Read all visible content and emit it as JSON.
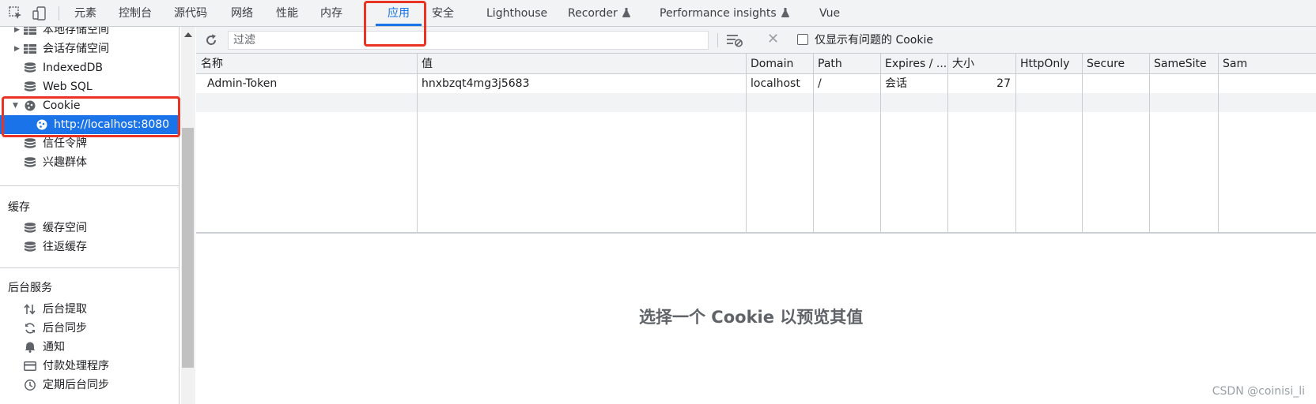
{
  "toolbar": {
    "tabs": [
      {
        "label": "元素"
      },
      {
        "label": "控制台"
      },
      {
        "label": "源代码"
      },
      {
        "label": "网络"
      },
      {
        "label": "性能"
      },
      {
        "label": "内存"
      },
      {
        "label": "应用",
        "active": true
      },
      {
        "label": "安全"
      },
      {
        "label": "Lighthouse"
      },
      {
        "label": "Recorder",
        "icon": "flask-icon"
      },
      {
        "label": "Performance insights",
        "icon": "flask-icon"
      },
      {
        "label": "Vue"
      }
    ]
  },
  "sidebar": {
    "storage_items": [
      {
        "label": "本地存储空间",
        "icon": "grid-icon"
      },
      {
        "label": "会话存储空间",
        "icon": "grid-icon"
      },
      {
        "label": "IndexedDB",
        "icon": "database-icon"
      },
      {
        "label": "Web SQL",
        "icon": "database-icon"
      },
      {
        "label": "Cookie",
        "icon": "cookie-icon"
      },
      {
        "label": "http://localhost:8080",
        "icon": "cookie-icon",
        "selected": true
      },
      {
        "label": "信任令牌",
        "icon": "database-icon"
      },
      {
        "label": "兴趣群体",
        "icon": "database-icon"
      }
    ],
    "cache": {
      "title": "缓存",
      "items": [
        {
          "label": "缓存空间",
          "icon": "database-icon"
        },
        {
          "label": "往返缓存",
          "icon": "database-icon"
        }
      ]
    },
    "background": {
      "title": "后台服务",
      "items": [
        {
          "label": "后台提取",
          "icon": "arrows-updown-icon"
        },
        {
          "label": "后台同步",
          "icon": "sync-icon"
        },
        {
          "label": "通知",
          "icon": "bell-icon"
        },
        {
          "label": "付款处理程序",
          "icon": "card-icon"
        },
        {
          "label": "定期后台同步",
          "icon": "clock-icon"
        }
      ]
    }
  },
  "filter": {
    "placeholder": "过滤",
    "only_issues_label": "仅显示有问题的 Cookie"
  },
  "table": {
    "columns": [
      "名称",
      "值",
      "Domain",
      "Path",
      "Expires / ...",
      "大小",
      "HttpOnly",
      "Secure",
      "SameSite",
      "Sam"
    ],
    "rows": [
      {
        "name": "Admin-Token",
        "value": "hnxbzqt4mg3j5683",
        "domain": "localhost",
        "path": "/",
        "expires": "会话",
        "size": "27",
        "httponly": "",
        "secure": "",
        "samesite": "",
        "sam": ""
      }
    ]
  },
  "preview_message": "选择一个 Cookie 以预览其值",
  "watermark": "CSDN @coinisi_li",
  "colors": {
    "accent": "#1a73e8",
    "highlight": "#ea3323",
    "toolbar_bg": "#f1f3f4"
  }
}
